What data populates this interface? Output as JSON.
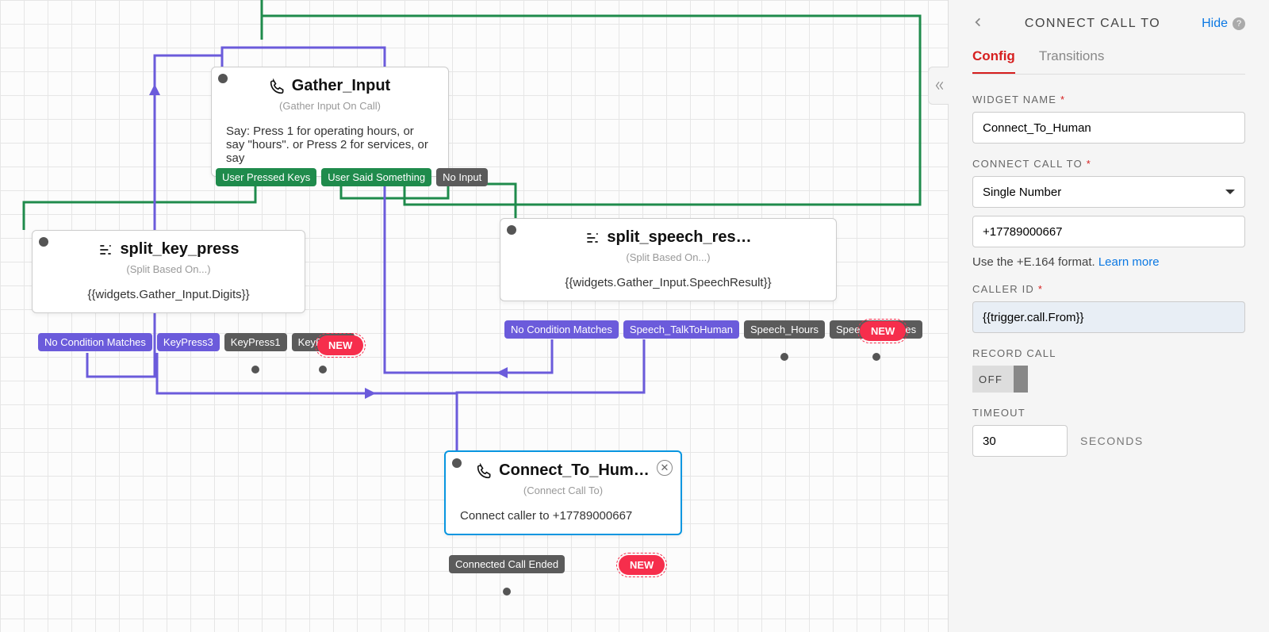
{
  "canvas": {
    "gather": {
      "title": "Gather_Input",
      "subtitle": "(Gather Input On Call)",
      "body": "Say: Press 1 for operating hours, or say \"hours\". or Press 2 for services, or say",
      "ports": [
        "User Pressed Keys",
        "User Said Something",
        "No Input"
      ]
    },
    "splitKey": {
      "title": "split_key_press",
      "subtitle": "(Split Based On...)",
      "body": "{{widgets.Gather_Input.Digits}}",
      "ports": [
        "No Condition Matches",
        "KeyPress3",
        "KeyPress1",
        "KeyPress2"
      ],
      "new": "NEW"
    },
    "splitSpeech": {
      "title": "split_speech_res…",
      "subtitle": "(Split Based On...)",
      "body": "{{widgets.Gather_Input.SpeechResult}}",
      "ports": [
        "No Condition Matches",
        "Speech_TalkToHuman",
        "Speech_Hours",
        "Speech_Services"
      ],
      "new": "NEW"
    },
    "connect": {
      "title": "Connect_To_Hum…",
      "subtitle": "(Connect Call To)",
      "body": "Connect caller to +17789000667",
      "ports": [
        "Connected Call Ended"
      ],
      "new": "NEW"
    }
  },
  "sidebar": {
    "title": "CONNECT CALL TO",
    "hide": "Hide",
    "tabs": {
      "config": "Config",
      "transitions": "Transitions"
    },
    "widgetNameLabel": "WIDGET NAME",
    "widgetName": "Connect_To_Human",
    "connectLabel": "CONNECT CALL TO",
    "connectSelect": "Single Number",
    "number": "+17789000667",
    "helper": "Use the +E.164 format.",
    "helperLink": "Learn more",
    "callerIdLabel": "CALLER ID",
    "callerId": "{{trigger.call.From}}",
    "recordLabel": "RECORD CALL",
    "recordState": "OFF",
    "timeoutLabel": "TIMEOUT",
    "timeout": "30",
    "timeoutUnit": "SECONDS"
  }
}
